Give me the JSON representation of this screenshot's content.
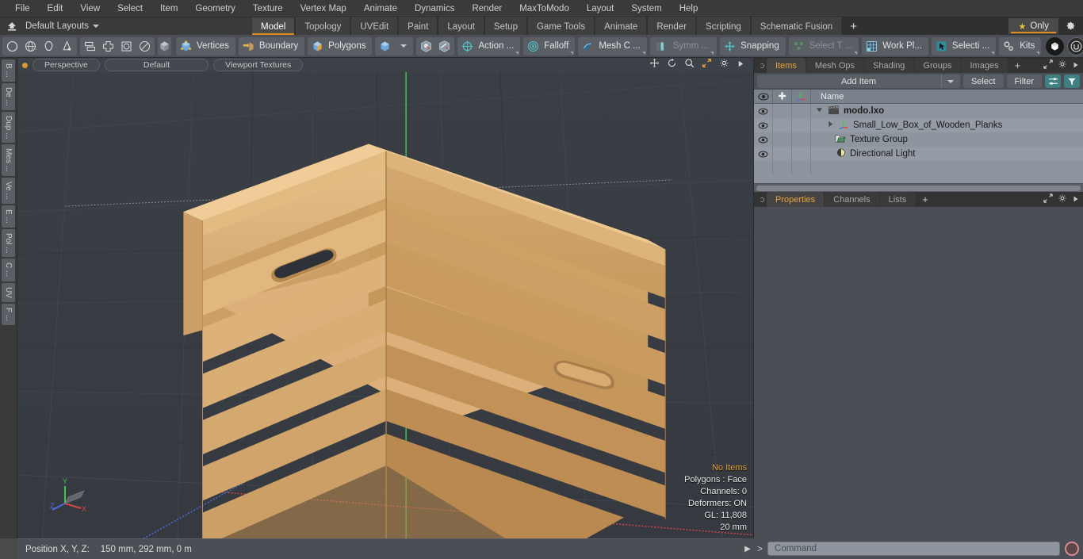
{
  "app": {
    "title": "modo",
    "accent": "#e08c22",
    "viewport_bg": "#383c42"
  },
  "menubar": {
    "items": [
      {
        "label": "File"
      },
      {
        "label": "Edit"
      },
      {
        "label": "View"
      },
      {
        "label": "Select"
      },
      {
        "label": "Item"
      },
      {
        "label": "Geometry"
      },
      {
        "label": "Texture"
      },
      {
        "label": "Vertex Map"
      },
      {
        "label": "Animate"
      },
      {
        "label": "Dynamics"
      },
      {
        "label": "Render"
      },
      {
        "label": "MaxToModo"
      },
      {
        "label": "Layout"
      },
      {
        "label": "System"
      },
      {
        "label": "Help"
      }
    ]
  },
  "layoutbar": {
    "layout_name": "Default Layouts",
    "home_icon": "home-up-icon",
    "tabs": [
      {
        "label": "Model",
        "active": true
      },
      {
        "label": "Topology",
        "active": false
      },
      {
        "label": "UVEdit",
        "active": false
      },
      {
        "label": "Paint",
        "active": false
      },
      {
        "label": "Layout",
        "active": false
      },
      {
        "label": "Setup",
        "active": false
      },
      {
        "label": "Game Tools",
        "active": false
      },
      {
        "label": "Animate",
        "active": false
      },
      {
        "label": "Render",
        "active": false
      },
      {
        "label": "Scripting",
        "active": false
      },
      {
        "label": "Schematic Fusion",
        "active": false
      }
    ],
    "add_tab_label": "+",
    "only_label": "Only",
    "star_icon": "star-icon",
    "gear_icon": "gear-icon"
  },
  "toolbar": {
    "shape_tools": [
      {
        "name": "circle-tool-icon"
      },
      {
        "name": "globe-tool-icon"
      },
      {
        "name": "teardrop-tool-icon"
      },
      {
        "name": "cone-tool-icon"
      }
    ],
    "mesh_tools": [
      {
        "name": "stack-tool-icon"
      },
      {
        "name": "grid-tool-icon"
      },
      {
        "name": "square-round-tool-icon"
      },
      {
        "name": "ellipse-tool-icon"
      }
    ],
    "cube_icon": "cube-icon",
    "selection_modes": [
      {
        "label": "Vertices",
        "icon": "vertices-icon"
      },
      {
        "label": "Boundary",
        "icon": "boundary-icon"
      },
      {
        "label": "Polygons",
        "icon": "polygons-icon"
      }
    ],
    "mode_dropdown_icon": "mode-cube-dropdown-icon",
    "snap_icons": [
      {
        "name": "snap-vertex-icon"
      },
      {
        "name": "snap-edge-icon"
      }
    ],
    "options": [
      {
        "label": "Action  ...",
        "icon": "action-center-icon"
      },
      {
        "label": "Falloff",
        "icon": "falloff-icon"
      },
      {
        "label": "Mesh C ...",
        "icon": "mesh-constraint-icon"
      },
      {
        "label": "Symm ...",
        "icon": "symmetry-icon"
      },
      {
        "label": "Snapping",
        "icon": "snapping-icon"
      }
    ],
    "right_options": [
      {
        "label": "Select T ...",
        "icon": "select-through-icon",
        "dim": true
      },
      {
        "label": "Work Pl...",
        "icon": "work-plane-icon",
        "dim": false
      },
      {
        "label": "Selecti ...",
        "icon": "selection-set-icon",
        "dim": false
      }
    ],
    "kits_label": "Kits",
    "kits_icon": "kits-gears-icon",
    "logo_icons": [
      {
        "name": "modo-cube-logo-icon"
      },
      {
        "name": "unreal-engine-logo-icon"
      }
    ]
  },
  "left_tool_tabs": [
    {
      "label": "B ..."
    },
    {
      "label": "De ..."
    },
    {
      "label": "Dup ..."
    },
    {
      "label": "Mes ..."
    },
    {
      "label": "Ve ..."
    },
    {
      "label": "E ..."
    },
    {
      "label": "Pol ..."
    },
    {
      "label": "C ..."
    },
    {
      "label": "UV"
    },
    {
      "label": "F ..."
    }
  ],
  "viewport": {
    "view_mode": "Perspective",
    "preset": "Default",
    "shading": "Viewport Textures",
    "controls": [
      {
        "name": "pan-icon"
      },
      {
        "name": "rotate-icon"
      },
      {
        "name": "zoom-icon"
      },
      {
        "name": "fit-icon"
      },
      {
        "name": "viewport-gear-icon"
      },
      {
        "name": "viewport-more-icon"
      }
    ],
    "hud": {
      "items_status": "No Items",
      "polygons": "Polygons : Face",
      "channels": "Channels: 0",
      "deformers": "Deformers: ON",
      "gl": "GL: 11,808",
      "scale": "20 mm"
    },
    "axis_gizmo": {
      "x": "X",
      "y": "Y",
      "z": "Z",
      "x_color": "#d8474a",
      "y_color": "#3fc94a",
      "z_color": "#4a6fe0"
    }
  },
  "right_panel": {
    "tabs": [
      {
        "label": "Items",
        "active": true
      },
      {
        "label": "Mesh Ops",
        "active": false
      },
      {
        "label": "Shading",
        "active": false
      },
      {
        "label": "Groups",
        "active": false
      },
      {
        "label": "Images",
        "active": false
      }
    ],
    "add_tab_label": "+",
    "panel_icons": [
      {
        "name": "expand-panel-icon"
      },
      {
        "name": "panel-gear-icon"
      },
      {
        "name": "panel-more-icon"
      }
    ],
    "add_item_label": "Add Item",
    "select_label": "Select",
    "filter_label": "Filter",
    "list_options_icon": "list-options-icon",
    "filter-funnel-icon": "filter-funnel-icon",
    "tree": {
      "headers": {
        "visibility_icon": "eye-icon",
        "lock_icon": "plus-lock-icon",
        "axis_icon": "axis-icon",
        "name": "Name"
      },
      "rows": [
        {
          "name": "modo.lxo",
          "icon": "scene-clapper-icon",
          "depth": 0,
          "bold": true,
          "expander": "expanded"
        },
        {
          "name": "Small_Low_Box_of_Wooden_Planks",
          "icon": "mesh-axis-icon",
          "depth": 1,
          "bold": false,
          "expander": "collapsed"
        },
        {
          "name": "Texture Group",
          "icon": "folder-icon",
          "depth": 1,
          "bold": false,
          "expander": "none"
        },
        {
          "name": "Directional Light",
          "icon": "light-icon",
          "depth": 1,
          "bold": false,
          "expander": "none"
        }
      ]
    },
    "props_tabs": [
      {
        "label": "Properties",
        "active": true
      },
      {
        "label": "Channels",
        "active": false
      },
      {
        "label": "Lists",
        "active": false
      }
    ],
    "props_add_label": "+"
  },
  "statusbar": {
    "position_label": "Position X, Y, Z:",
    "position_value": "150 mm, 292 mm, 0 m",
    "command_prompt": ">",
    "command_placeholder": "Command",
    "record_icon": "record-circle-icon"
  }
}
